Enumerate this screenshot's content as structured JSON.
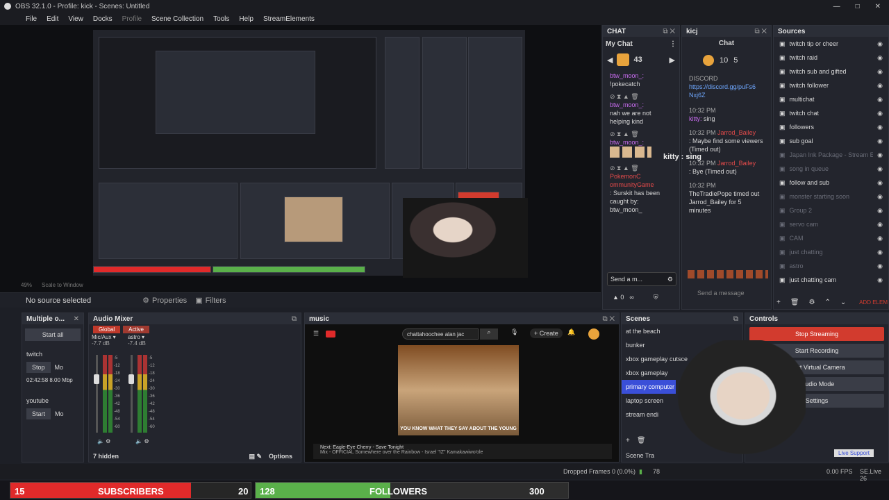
{
  "window": {
    "title": "OBS 32.1.0 - Profile: kick - Scenes: Untitled",
    "controls": [
      "—",
      "□",
      "✕"
    ]
  },
  "menu": [
    "File",
    "Edit",
    "View",
    "Docks",
    "Profile",
    "Scene Collection",
    "Tools",
    "Help",
    "StreamElements"
  ],
  "preview": {
    "zoom": "49%",
    "scale": "Scale to Window"
  },
  "source_bar": {
    "status": "No source selected",
    "properties": "Properties",
    "filters": "Filters"
  },
  "chat_dock": {
    "title": "CHAT",
    "header": "My Chat",
    "badge": "43",
    "messages": [
      {
        "user": "btw_moon_:",
        "text": "!pokecatch"
      },
      {
        "user": "btw_moon_:",
        "text": "nah we are not helping kind"
      },
      {
        "user": "btw_moon_:",
        "text": ""
      },
      {
        "user": "PokemonC ommunityGame",
        "text": ": Surskit has been caught by: btw_moon_"
      }
    ],
    "input_placeholder": "Send a m..."
  },
  "kicj_dock": {
    "title": "kicj",
    "header": "Chat",
    "counts": [
      "10",
      "5"
    ],
    "discord_label": "DISCORD",
    "link": "https://discord.gg/puFs6 Nxj6Z",
    "messages": [
      {
        "time": "10:32 PM",
        "user": "kitty:",
        "text": "sing"
      },
      {
        "time": "10:32 PM",
        "user": "Jarrod_Bailey",
        "text": ": Maybe find some viewers (Timed out)"
      },
      {
        "time": "10:32 PM",
        "user": "Jarrod_Bailey",
        "text": ": Bye (Timed out)"
      },
      {
        "time": "10:32 PM",
        "user": "TheTradiePope",
        "text": "timed out Jarrod_Bailey for 5 minutes"
      }
    ],
    "input_placeholder": "Send a message",
    "overlay_text": "kitty : sing"
  },
  "sources_dock": {
    "title": "Sources",
    "items": [
      {
        "label": "twitch tip or cheer",
        "dim": false
      },
      {
        "label": "twitch raid",
        "dim": false
      },
      {
        "label": "twitch sub and gifted",
        "dim": false
      },
      {
        "label": "twitch follower",
        "dim": false
      },
      {
        "label": "multichat",
        "dim": false
      },
      {
        "label": "twitch chat",
        "dim": false
      },
      {
        "label": "followers",
        "dim": false
      },
      {
        "label": "sub goal",
        "dim": false
      },
      {
        "label": "Japan Ink Package - Stream Ende",
        "dim": true
      },
      {
        "label": "song in queue",
        "dim": true
      },
      {
        "label": "follow and sub",
        "dim": false
      },
      {
        "label": "monster starting soon",
        "dim": true
      },
      {
        "label": "Group 2",
        "dim": true
      },
      {
        "label": "servo cam",
        "dim": true
      },
      {
        "label": "CAM",
        "dim": true
      },
      {
        "label": "just chatting",
        "dim": true
      },
      {
        "label": "astro",
        "dim": true
      },
      {
        "label": "just chatting cam",
        "dim": false
      }
    ],
    "add_element": "ADD ELEM"
  },
  "multi_dock": {
    "title": "Multiple o...",
    "start_all": "Start all",
    "targets": [
      {
        "name": "twitch",
        "btn": "Stop",
        "extra": "Mo",
        "stat": "02:42:58 8.00 Mbp"
      },
      {
        "name": "youtube",
        "btn": "Start",
        "extra": "Mo"
      }
    ]
  },
  "mixer_dock": {
    "title": "Audio Mixer",
    "tabs": [
      "Global",
      "Active"
    ],
    "channels": [
      {
        "name": "Mic/Aux",
        "db": "-7.7 dB"
      },
      {
        "name": "astro",
        "db": "-7.4 dB"
      }
    ],
    "scale": [
      "-5",
      "-12",
      "-18",
      "-24",
      "-30",
      "-36",
      "-42",
      "-48",
      "-54",
      "-60"
    ],
    "hidden": "7 hidden",
    "options": "Options"
  },
  "music_dock": {
    "title": "music",
    "search": "chattahoochee alan jac",
    "create": "Create",
    "caption": "YOU KNOW WHAT THEY SAY ABOUT THE YOUNG",
    "next": "Next: Eagle-Eye Cherry - Save Tonight",
    "next_sub": "Mix - OFFICIAL Somewhere over the Rainbow - Israel \"IZ\" Kamakawiwo'ole"
  },
  "scenes_dock": {
    "title": "Scenes",
    "items": [
      "at the beach",
      "bunker",
      "xbox gameplay cutsce",
      "xbox gameplay",
      "primary computer",
      "laptop screen",
      "stream endi"
    ],
    "selected": 4,
    "transition": "Scene Tra"
  },
  "controls_dock": {
    "title": "Controls",
    "buttons": [
      "Stop Streaming",
      "Start Recording",
      "Start Virtual Camera",
      "Studio Mode",
      "Settings"
    ]
  },
  "status": {
    "dropped": "Dropped Frames 0 (0.0%)",
    "fps": "0.00 FPS",
    "se": "SE.Live 26",
    "live_support": "Live Support",
    "cpu": "78"
  },
  "overlay": {
    "sub_count": "15",
    "sub_label": "SUBSCRIBERS",
    "sub_goal": "20",
    "fol_count": "128",
    "fol_label": "FOLLOWERS",
    "fol_goal": "300",
    "sub_progress": 0.75,
    "fol_progress": 0.43
  },
  "colors": {
    "accent": "#3a4fd8",
    "stream_red": "#d23b2e",
    "sub_bar": "#e02a2a",
    "fol_bar": "#5ab04a",
    "username": "#c86cf0"
  }
}
